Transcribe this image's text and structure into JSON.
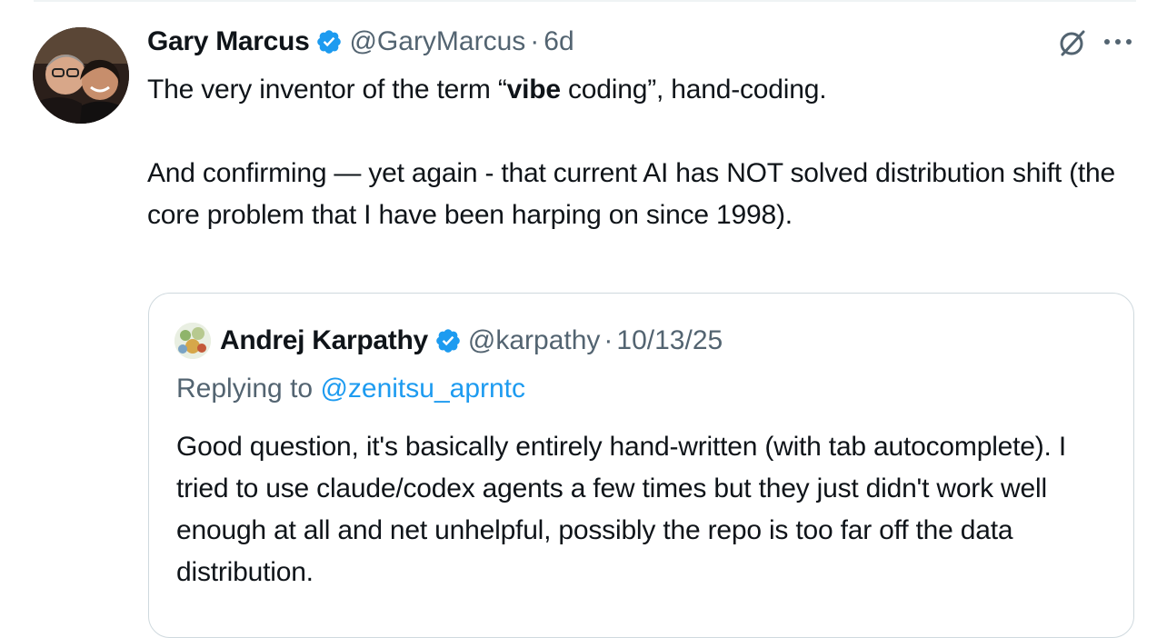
{
  "tweet": {
    "author_name": "Gary Marcus",
    "handle": "@GaryMarcus",
    "separator": "·",
    "time": "6d",
    "text": {
      "line1_before": "The very inventor of the term “",
      "line1_bold": "vibe",
      "line1_after": " coding”, hand-coding.",
      "para2": "And confirming — yet again - that current AI has NOT solved distribution shift (the core problem that I have been harping on since 1998)."
    }
  },
  "quoted_tweet": {
    "author_name": "Andrej Karpathy",
    "handle": "@karpathy",
    "separator": "·",
    "time": "10/13/25",
    "replying_prefix": "Replying to ",
    "replying_mention": "@zenitsu_aprntc",
    "text": "Good question, it's basically entirely hand-written (with tab autocomplete). I tried to use claude/codex agents a few times but they just didn't work well enough at all and net unhelpful, possibly the repo is too far off the data distribution."
  },
  "icons": {
    "verified": "verified-badge-icon",
    "grok": "grok-icon",
    "more": "more-options-icon"
  },
  "colors": {
    "text": "#0f1419",
    "secondary": "#536471",
    "accent": "#1d9bf0",
    "border": "#cfd9de"
  }
}
